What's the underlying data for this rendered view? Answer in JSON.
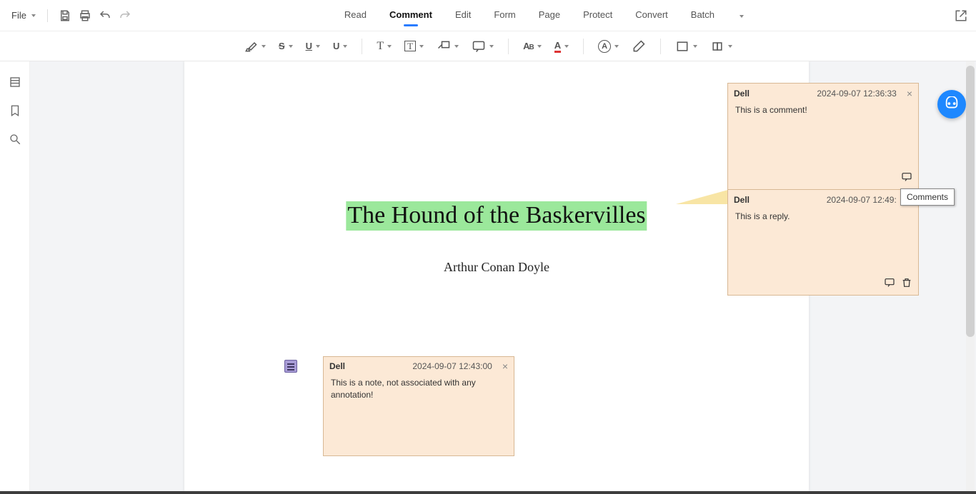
{
  "menu": {
    "file_label": "File",
    "tabs": [
      "Read",
      "Comment",
      "Edit",
      "Form",
      "Page",
      "Protect",
      "Convert",
      "Batch"
    ],
    "active_tab_index": 1
  },
  "quick_actions": {
    "save": "save-icon",
    "print": "print-icon",
    "undo": "undo-icon",
    "redo": "redo-icon"
  },
  "toolbar_groups": {
    "highlight": "A",
    "strike": "S",
    "underline": "U",
    "squiggly": "U",
    "text": "T",
    "textbox": "T",
    "callout": "callout",
    "note_tool": "note",
    "fontsize": "AB",
    "textcolor": "A",
    "stamp": "A",
    "eraser": "eraser",
    "shapes": "rect",
    "shapes2": "rect"
  },
  "document": {
    "title_text": "The Hound of the Baskervilles",
    "author_text": "Arthur Conan Doyle"
  },
  "note_popup": {
    "author": "Dell",
    "timestamp": "2024-09-07 12:43:00",
    "body": "This is a note, not associated with any annotation!"
  },
  "comment_popup": {
    "segments": [
      {
        "author": "Dell",
        "timestamp": "2024-09-07 12:36:33",
        "body": "This is a comment!"
      },
      {
        "author": "Dell",
        "timestamp": "2024-09-07 12:49:",
        "body": "This is a reply."
      }
    ]
  },
  "tooltip": {
    "text": "Comments"
  },
  "siderail": {
    "items": [
      "thumbnails-icon",
      "bookmarks-icon",
      "search-icon"
    ]
  }
}
